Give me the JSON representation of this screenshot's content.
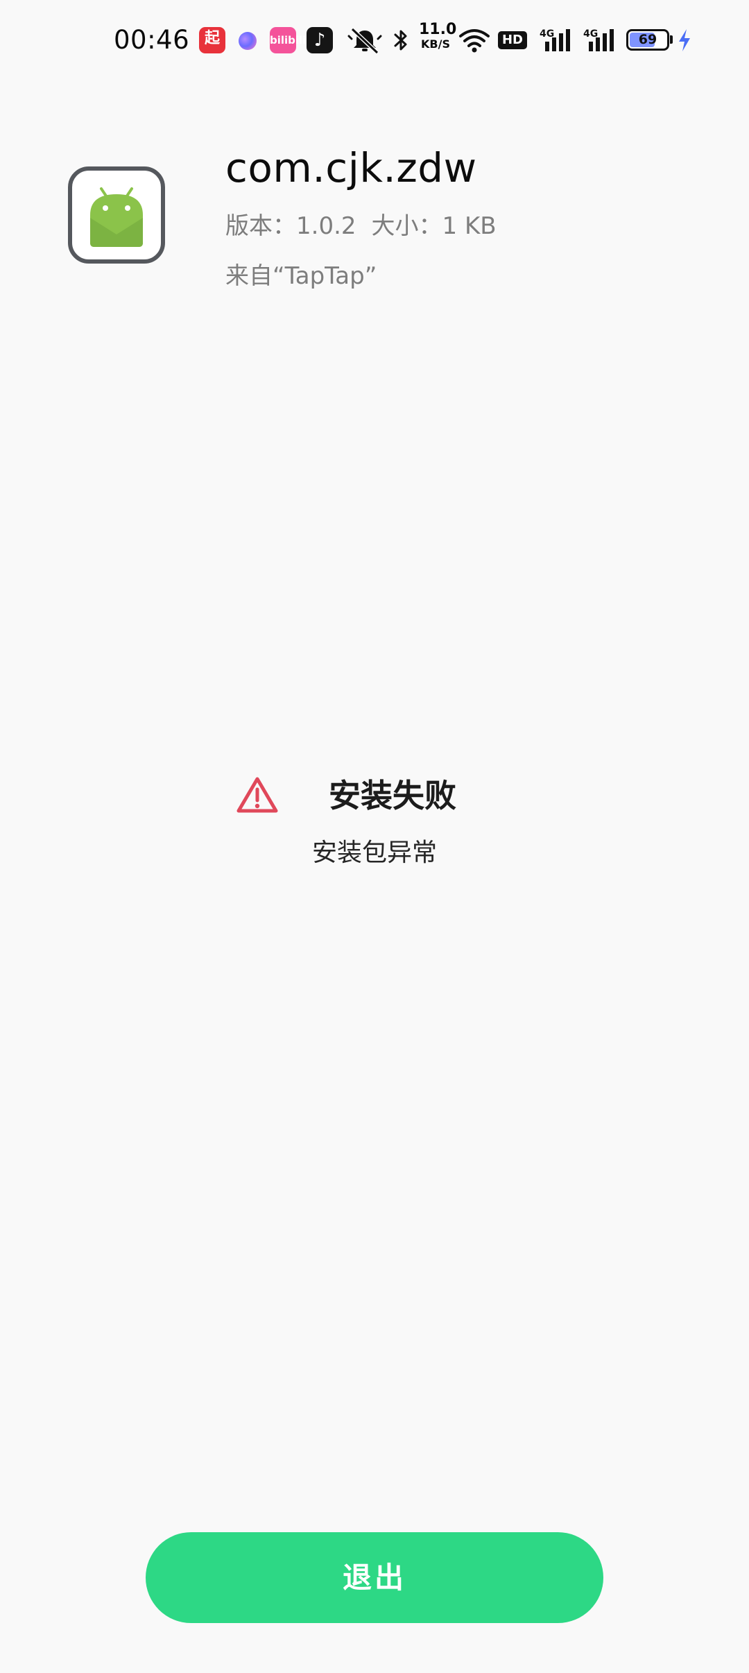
{
  "status_bar": {
    "time": "00:46",
    "apps": [
      "qidian-icon",
      "assistant-icon",
      "bilibili-icon",
      "tiktok-icon"
    ],
    "qidian_label": "起",
    "bili_label": "bilibili",
    "net_speed_value": "11.0",
    "net_speed_unit": "KB/S",
    "hd_label": "HD",
    "sig1_label": "4G",
    "sig2_label": "4G",
    "battery_level": "69",
    "battery_percent": 69,
    "battery_color": "#7f94ff",
    "charging_color": "#4b6ef5"
  },
  "app": {
    "name": "com.cjk.zdw",
    "version_label": "版本：1.0.2",
    "size_label": "大小：1 KB",
    "source_label": "来自“TapTap”"
  },
  "result": {
    "title": "安装失败",
    "subtitle": "安装包异常",
    "warning_color": "#e0485a"
  },
  "actions": {
    "exit_label": "退出",
    "button_color": "#2dd885"
  }
}
